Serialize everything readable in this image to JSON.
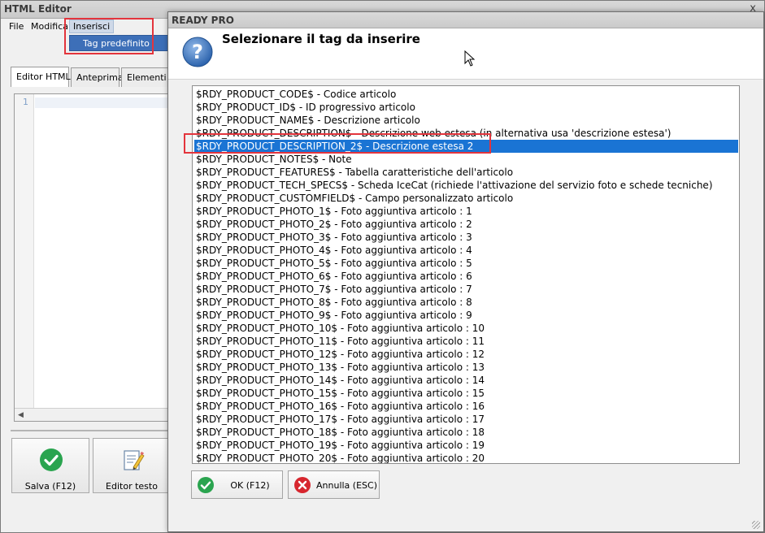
{
  "background_window": {
    "title": "HTML Editor",
    "close_glyph": "x",
    "menu": {
      "file": "File",
      "modifica": "Modifica",
      "inserisci": "Inserisci",
      "dropdown_item": "Tag predefinito"
    },
    "tabs": [
      "Editor HTML",
      "Anteprima",
      "Elementi HTML"
    ],
    "editor": {
      "line_number": "1"
    },
    "buttons": {
      "save": "Salva (F12)",
      "text_editor": "Editor testo"
    }
  },
  "dialog": {
    "title": "READY PRO",
    "heading": "Selezionare il tag da inserire",
    "selected_index": 4,
    "items": [
      "$RDY_PRODUCT_CODE$ - Codice articolo",
      "$RDY_PRODUCT_ID$ - ID progressivo articolo",
      "$RDY_PRODUCT_NAME$ - Descrizione articolo",
      "$RDY_PRODUCT_DESCRIPTION$ - Descrizione web estesa (in alternativa usa 'descrizione estesa')",
      "$RDY_PRODUCT_DESCRIPTION_2$ - Descrizione estesa 2",
      "$RDY_PRODUCT_NOTES$ - Note",
      "$RDY_PRODUCT_FEATURES$ - Tabella caratteristiche dell'articolo",
      "$RDY_PRODUCT_TECH_SPECS$ - Scheda IceCat (richiede l'attivazione del servizio foto e schede tecniche)",
      "$RDY_PRODUCT_CUSTOMFIELD$ - Campo personalizzato articolo",
      "$RDY_PRODUCT_PHOTO_1$ - Foto aggiuntiva articolo : 1",
      "$RDY_PRODUCT_PHOTO_2$ - Foto aggiuntiva articolo : 2",
      "$RDY_PRODUCT_PHOTO_3$ - Foto aggiuntiva articolo : 3",
      "$RDY_PRODUCT_PHOTO_4$ - Foto aggiuntiva articolo : 4",
      "$RDY_PRODUCT_PHOTO_5$ - Foto aggiuntiva articolo : 5",
      "$RDY_PRODUCT_PHOTO_6$ - Foto aggiuntiva articolo : 6",
      "$RDY_PRODUCT_PHOTO_7$ - Foto aggiuntiva articolo : 7",
      "$RDY_PRODUCT_PHOTO_8$ - Foto aggiuntiva articolo : 8",
      "$RDY_PRODUCT_PHOTO_9$ - Foto aggiuntiva articolo : 9",
      "$RDY_PRODUCT_PHOTO_10$ - Foto aggiuntiva articolo : 10",
      "$RDY_PRODUCT_PHOTO_11$ - Foto aggiuntiva articolo : 11",
      "$RDY_PRODUCT_PHOTO_12$ - Foto aggiuntiva articolo : 12",
      "$RDY_PRODUCT_PHOTO_13$ - Foto aggiuntiva articolo : 13",
      "$RDY_PRODUCT_PHOTO_14$ - Foto aggiuntiva articolo : 14",
      "$RDY_PRODUCT_PHOTO_15$ - Foto aggiuntiva articolo : 15",
      "$RDY_PRODUCT_PHOTO_16$ - Foto aggiuntiva articolo : 16",
      "$RDY_PRODUCT_PHOTO_17$ - Foto aggiuntiva articolo : 17",
      "$RDY_PRODUCT_PHOTO_18$ - Foto aggiuntiva articolo : 18",
      "$RDY_PRODUCT_PHOTO_19$ - Foto aggiuntiva articolo : 19",
      "$RDY_PRODUCT_PHOTO_20$ - Foto aggiuntiva articolo : 20"
    ],
    "buttons": {
      "ok": "OK (F12)",
      "cancel": "Annulla (ESC)"
    }
  },
  "icons": {
    "save": "check-circle-icon",
    "text_editor": "pencil-document-icon",
    "help": "question-mark-icon",
    "ok": "check-circle-icon",
    "cancel": "cancel-x-icon"
  },
  "colors": {
    "selection": "#1a74d4",
    "annotation_red": "#e3343c",
    "ok_green": "#2aa44f",
    "cancel_red": "#d7262e",
    "help_blue": "#3f7cc4"
  }
}
